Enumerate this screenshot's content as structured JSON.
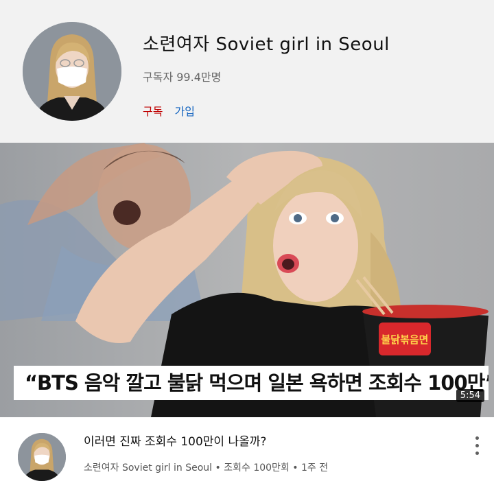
{
  "channel": {
    "name": "소련여자 Soviet girl in Seoul",
    "subscribers": "구독자 99.4만명",
    "subscribe_label": "구독",
    "join_label": "가입"
  },
  "thumbnail": {
    "caption": "“BTS 음악 깔고 불닭 먹으며 일본 욕하면 조회수 100만”",
    "duration": "5:54",
    "package_text": "불닭볶음면"
  },
  "video": {
    "title": "이러면 진짜 조회수 100만이 나올까?",
    "channel": "소련여자 Soviet girl in Seoul",
    "views": "조회수 100만회",
    "age": "1주 전",
    "separator": "•"
  }
}
